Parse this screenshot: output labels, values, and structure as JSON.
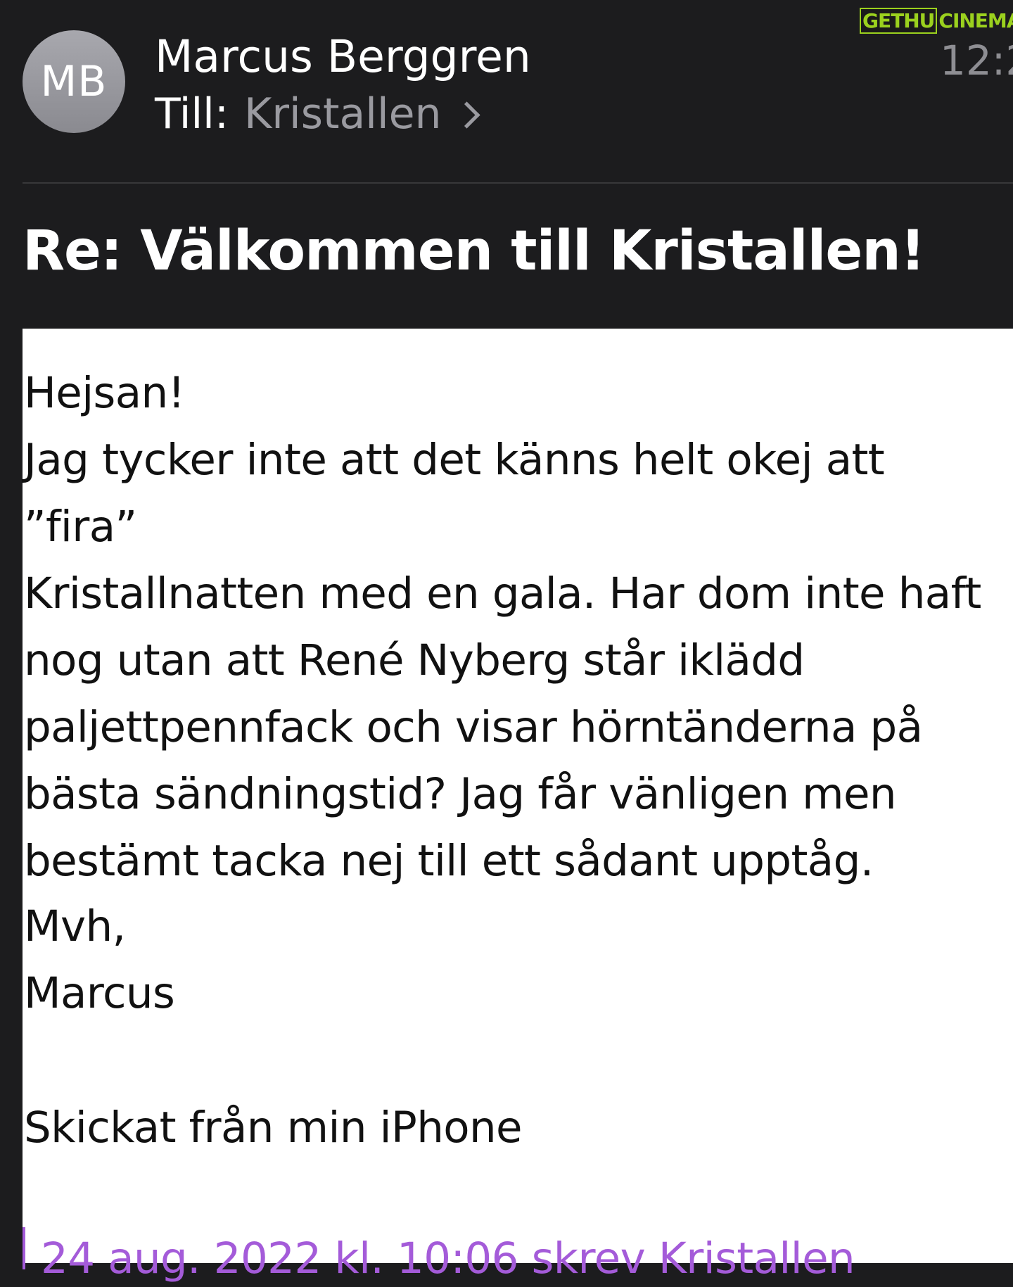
{
  "watermark": {
    "part1": "GETHU",
    "part2": "CINEMA"
  },
  "header": {
    "avatar_initials": "MB",
    "sender_name": "Marcus Berggren",
    "recipient_label": "Till:",
    "recipient_name": "Kristallen",
    "time": "12:2"
  },
  "subject": "Re: Välkommen till Kristallen!",
  "body": {
    "greeting": "Hejsan!",
    "paragraph": "Jag tycker inte att det känns helt okej att ”fira”\nKristallnatten med en gala. Har dom inte haft\nnog utan att René Nyberg står iklädd\npaljettpennfack och visar hörntänderna på\nbästa sändningstid? Jag får vänligen men\nbestämt tacka nej till ett sådant upptåg.",
    "closing": "Mvh,",
    "signature": "Marcus",
    "sent_from": "Skickat från min iPhone",
    "quote_header": "24 aug. 2022 kl. 10:06 skrev Kristallen"
  }
}
